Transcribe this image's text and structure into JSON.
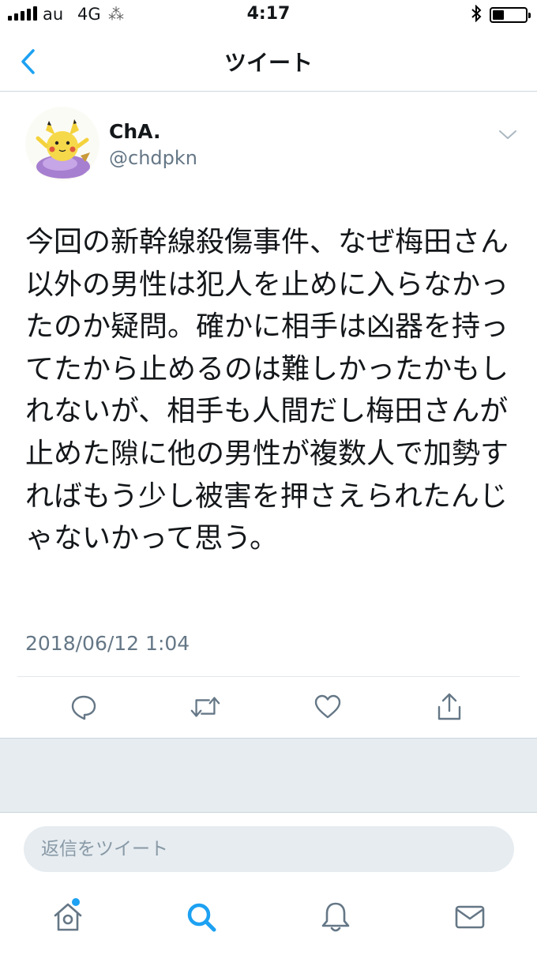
{
  "status_bar": {
    "carrier": "au",
    "network": "4G",
    "time": "4:17",
    "battery_level": 0.35
  },
  "nav": {
    "title": "ツイート"
  },
  "tweet": {
    "display_name": "ChA.",
    "handle": "@chdpkn",
    "text": "今回の新幹線殺傷事件、なぜ梅田さん以外の男性は犯人を止めに入らなかったのか疑問。確かに相手は凶器を持ってたから止めるのは難しかったかもしれないが、相手も人間だし梅田さんが止めた隙に他の男性が複数人で加勢すればもう少し被害を押さえられたんじゃないかって思う。",
    "timestamp": "2018/06/12 1:04"
  },
  "reply": {
    "placeholder": "返信をツイート"
  },
  "colors": {
    "accent": "#1da1f2",
    "icon_grey": "#657786",
    "separator": "#e6ecf0"
  }
}
